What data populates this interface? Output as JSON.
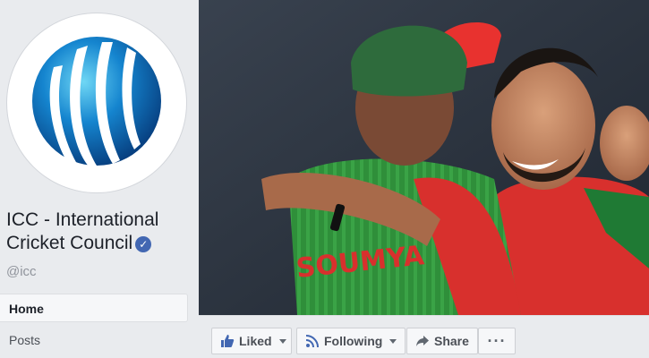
{
  "page": {
    "name_line1": "ICC - International",
    "name_line2": "Cricket Council",
    "handle": "@icc",
    "verified": true,
    "verified_glyph": "✓"
  },
  "logo": {
    "registered_mark": "®",
    "colors": {
      "primary": "#0a6bb8",
      "accent": "#35c3e8",
      "ring": "#ffffff"
    }
  },
  "nav": {
    "items": [
      {
        "label": "Home",
        "active": true
      },
      {
        "label": "Posts",
        "active": false
      }
    ]
  },
  "cover": {
    "jersey_text": "SOUMYA",
    "colors": {
      "jersey_green": "#2f8f3a",
      "jersey_red": "#e8322f",
      "cap": "#2e6b3c",
      "background": "#2a3340"
    }
  },
  "actions": {
    "liked_label": "Liked",
    "following_label": "Following",
    "share_label": "Share",
    "more_label": "···"
  },
  "colors": {
    "accent": "#4267b2",
    "text_dark": "#1d2129",
    "text_muted": "#90949c",
    "background": "#e9ebee"
  }
}
